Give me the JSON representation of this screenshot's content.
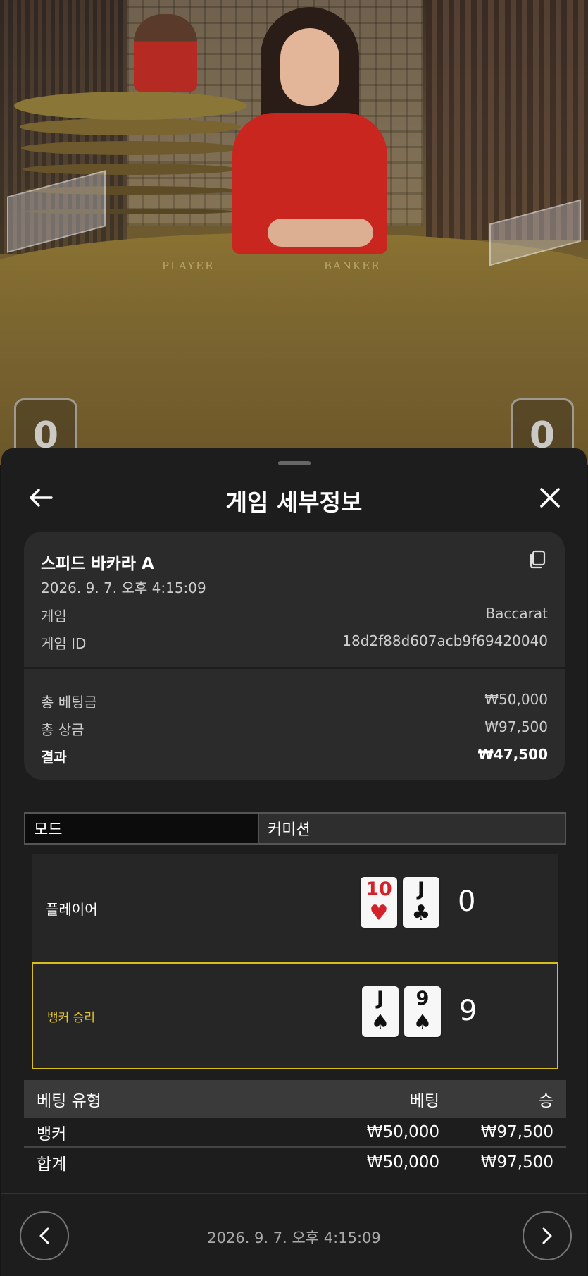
{
  "video": {
    "felt_player_label": "PLAYER",
    "felt_banker_label": "BANKER",
    "player_score": "0",
    "banker_score": "0"
  },
  "header": {
    "title": "게임 세부정보"
  },
  "summary": {
    "game_name": "스피드 바카라 A",
    "datetime": "2026. 9. 7. 오후 4:15:09",
    "game_label": "게임",
    "game_value": "Baccarat",
    "game_id_label": "게임 ID",
    "game_id_value": "18d2f88d607acb9f69420040",
    "total_bet_label": "총 베팅금",
    "total_bet_value": "₩50,000",
    "total_win_label": "총 상금",
    "total_win_value": "₩97,500",
    "result_label": "결과",
    "result_value": "₩47,500"
  },
  "mode": {
    "label": "모드",
    "value": "커미션"
  },
  "hands": {
    "player": {
      "label": "플레이어",
      "score": "0",
      "cards": [
        {
          "rank": "10",
          "suit": "♥",
          "color": "#d3222a"
        },
        {
          "rank": "J",
          "suit": "♣",
          "color": "#111111"
        }
      ]
    },
    "banker": {
      "label": "뱅커 승리",
      "score": "9",
      "cards": [
        {
          "rank": "J",
          "suit": "♠",
          "color": "#111111"
        },
        {
          "rank": "9",
          "suit": "♠",
          "color": "#111111"
        }
      ]
    }
  },
  "bets": {
    "headers": {
      "type": "베팅 유형",
      "bet": "베팅",
      "win": "승"
    },
    "rows": [
      {
        "type": "뱅커",
        "bet": "₩50,000",
        "win": "₩97,500"
      },
      {
        "type": "합계",
        "bet": "₩50,000",
        "win": "₩97,500"
      }
    ]
  },
  "footer": {
    "datetime": "2026. 9. 7. 오후 4:15:09"
  },
  "colors": {
    "accent": "#d9bd1e",
    "background": "#1d1d1d",
    "card_bg": "#2b2b2b"
  },
  "icons": {
    "back": "arrow-left-icon",
    "close": "close-icon",
    "copy": "copy-icon",
    "prev": "chevron-left-icon",
    "next": "chevron-right-icon"
  }
}
